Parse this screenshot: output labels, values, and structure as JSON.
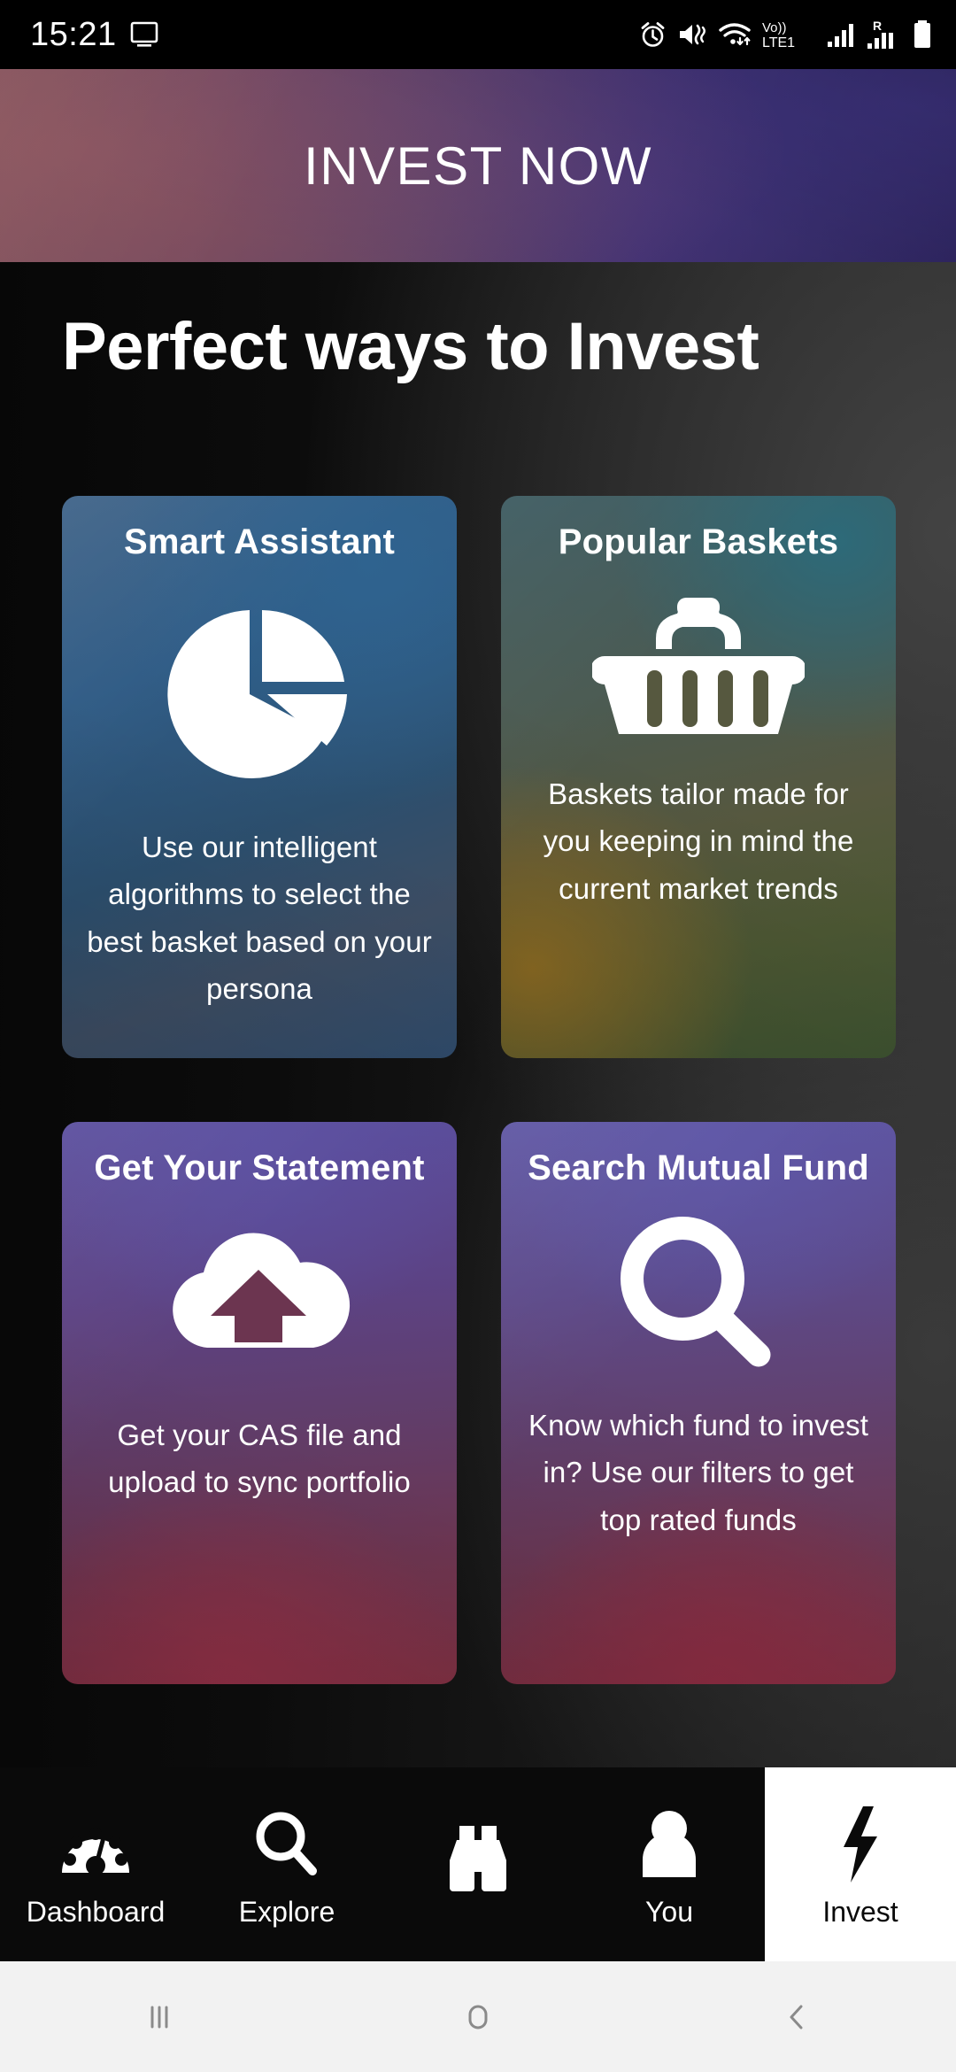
{
  "status_bar": {
    "time": "15:21",
    "left_icons": [
      "desktop-monitor-icon"
    ],
    "right_icons": [
      "alarm-icon",
      "mute-vibrate-icon",
      "wifi-icon",
      "volte-icon",
      "signal-bars-icon",
      "roaming-signal-icon",
      "battery-icon"
    ],
    "network_label": "Vo)) LTE1",
    "roaming_label": "R"
  },
  "banner": {
    "title": "INVEST NOW",
    "gradient_from": "#7e4f59",
    "gradient_to": "#2b2259"
  },
  "page": {
    "title": "Perfect ways to Invest"
  },
  "cards": [
    {
      "title": "Smart Assistant",
      "description": "Use our intelligent algorithms to select the best basket based on your persona",
      "icon": "pie-chart-icon",
      "accent": "#3f6388"
    },
    {
      "title": "Popular Baskets",
      "description": "Baskets tailor made for you keeping in mind the current market trends",
      "icon": "shopping-basket-icon",
      "accent": "#56583f"
    },
    {
      "title": "Get Your Statement",
      "description": "Get your CAS file and upload to sync portfolio",
      "icon": "cloud-upload-icon",
      "accent": "#6c3550"
    },
    {
      "title": "Search Mutual Fund",
      "description": "Know which fund to invest in? Use our filters to get top rated funds",
      "icon": "magnifier-icon",
      "accent": "#6d3752"
    }
  ],
  "bottom_nav": {
    "items": [
      {
        "label": "Dashboard",
        "icon": "speedometer-icon",
        "active": false
      },
      {
        "label": "Explore",
        "icon": "magnifier-icon",
        "active": false
      },
      {
        "label": "",
        "icon": "binoculars-icon",
        "active": false
      },
      {
        "label": "You",
        "icon": "person-icon",
        "active": false
      },
      {
        "label": "Invest",
        "icon": "lightning-bolt-icon",
        "active": true
      }
    ],
    "active_bg": "#ffffff",
    "bg": "#0a0a0a"
  },
  "system_nav": {
    "buttons": [
      "recent-apps-icon",
      "home-icon",
      "back-icon"
    ],
    "bg": "#f2f2f2",
    "icon_color": "#8a8a8a"
  }
}
